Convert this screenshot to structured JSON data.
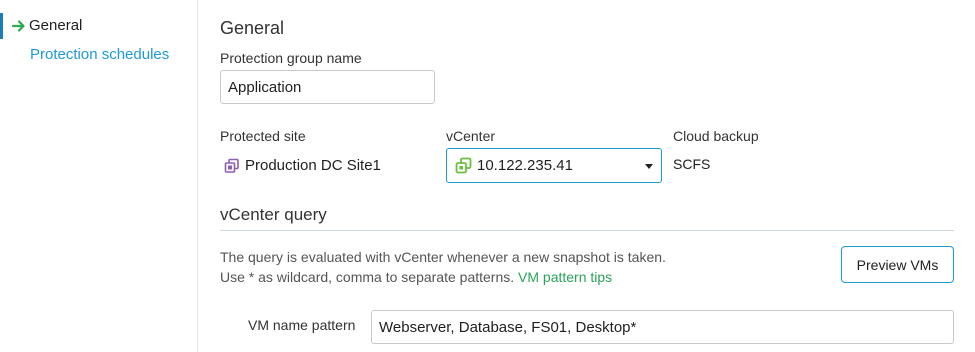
{
  "sidebar": {
    "items": [
      {
        "label": "General",
        "active": true
      },
      {
        "label": "Protection schedules",
        "active": false
      }
    ]
  },
  "general": {
    "title": "General",
    "group_name_label": "Protection group name",
    "group_name_value": "Application",
    "protected_site_label": "Protected site",
    "protected_site_value": "Production DC Site1",
    "vcenter_label": "vCenter",
    "vcenter_value": "10.122.235.41",
    "cloud_backup_label": "Cloud backup",
    "cloud_backup_value": "SCFS"
  },
  "query": {
    "title": "vCenter query",
    "help_line1": "The query is evaluated with vCenter whenever a new snapshot is taken.",
    "help_line2": "Use * as wildcard, comma to separate patterns.",
    "help_link": "VM pattern tips",
    "preview_button": "Preview VMs",
    "vm_name_label": "VM name pattern",
    "vm_name_value": "Webserver, Database, FS01, Desktop*"
  },
  "colors": {
    "accent": "#1d9ad6",
    "link_green": "#29a35a",
    "active_arrow": "#2eaa4f",
    "site_icon": "#8e5fb6",
    "vcenter_icon": "#6cbf3c"
  },
  "icons": {
    "active_nav": "arrow-right-icon",
    "protected_site": "site-icon",
    "vcenter": "vcenter-icon",
    "dropdown": "chevron-down-icon"
  }
}
